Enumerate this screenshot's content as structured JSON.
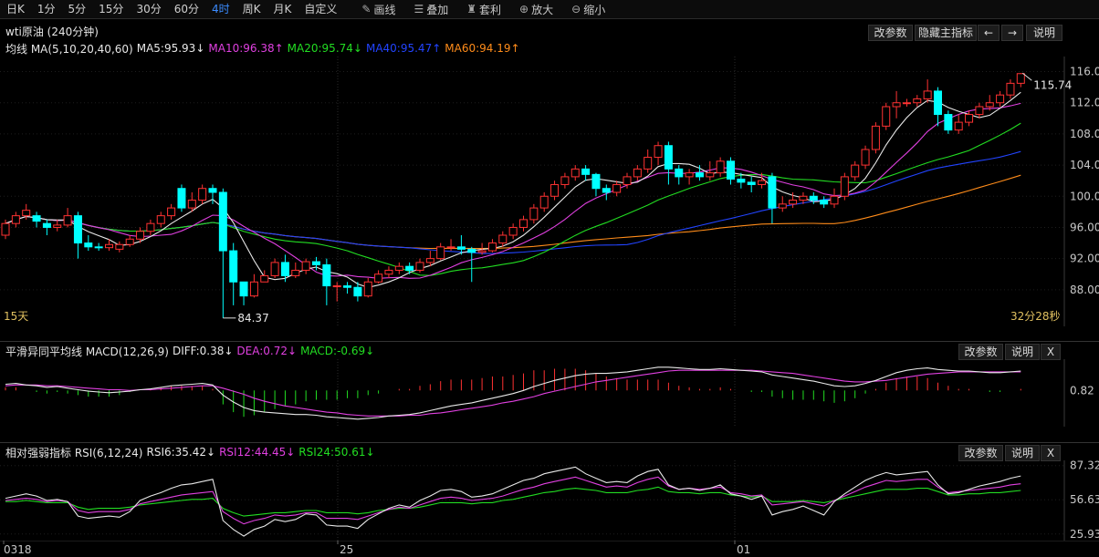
{
  "toolbar": {
    "periods": [
      "日K",
      "1分",
      "5分",
      "15分",
      "30分",
      "60分",
      "4时",
      "周K",
      "月K",
      "自定义"
    ],
    "active_period": "4时",
    "tools": [
      {
        "label": "画线",
        "icon": "pencil-icon"
      },
      {
        "label": "叠加",
        "icon": "stack-icon"
      },
      {
        "label": "套利",
        "icon": "bag-icon"
      },
      {
        "label": "放大",
        "icon": "zoom-in-icon"
      },
      {
        "label": "缩小",
        "icon": "zoom-out-icon"
      }
    ]
  },
  "main": {
    "title": "wti原油 (240分钟)",
    "buttons": {
      "params": "改参数",
      "hide": "隐藏主指标",
      "left": "←",
      "right": "→",
      "help": "说明"
    },
    "indicator": {
      "name": "均线 MA(5,10,20,40,60)",
      "items": [
        {
          "text": "MA5:95.93↓",
          "color": "#e8e8e8"
        },
        {
          "text": "MA10:96.38↑",
          "color": "#e040e0"
        },
        {
          "text": "MA20:95.74↓",
          "color": "#22dd22"
        },
        {
          "text": "MA40:95.47↑",
          "color": "#2244ff"
        },
        {
          "text": "MA60:94.19↑",
          "color": "#ff8c1a"
        }
      ]
    },
    "period_label": "15天",
    "timer": "32分28秒",
    "high_label": "115.74",
    "low_label": "84.37"
  },
  "macd": {
    "title": "平滑异同平均线 MACD(12,26,9)",
    "items": [
      {
        "text": "DIFF:0.38↓",
        "color": "#e8e8e8"
      },
      {
        "text": "DEA:0.72↓",
        "color": "#e040e0"
      },
      {
        "text": "MACD:-0.69↓",
        "color": "#22dd22"
      }
    ],
    "buttons": {
      "params": "改参数",
      "help": "说明",
      "close": "X"
    },
    "axis_label": "0.82"
  },
  "rsi": {
    "title": "相对强弱指标 RSI(6,12,24)",
    "items": [
      {
        "text": "RSI6:35.42↓",
        "color": "#e8e8e8"
      },
      {
        "text": "RSI12:44.45↓",
        "color": "#e040e0"
      },
      {
        "text": "RSI24:50.61↓",
        "color": "#22dd22"
      }
    ],
    "buttons": {
      "params": "改参数",
      "help": "说明",
      "close": "X"
    },
    "axis_labels": [
      "87.32",
      "56.63",
      "25.93"
    ]
  },
  "x_axis": [
    "0318",
    "25",
    "01"
  ],
  "chart_data": [
    {
      "type": "candlestick",
      "y_ticks": [
        "116.00",
        "112.00",
        "108.00",
        "104.00",
        "100.00",
        "96.00",
        "92.00",
        "88.00"
      ],
      "ylim": [
        84,
        117
      ],
      "colors": {
        "up": "#ff3232",
        "down": "#00ffff",
        "ma5": "#e8e8e8",
        "ma10": "#e040e0",
        "ma20": "#22dd22",
        "ma40": "#2244ff",
        "ma60": "#ff8c1a"
      },
      "candles": [
        [
          95,
          96.5,
          94.5,
          97
        ],
        [
          96.5,
          97.5,
          96,
          98
        ],
        [
          97.5,
          98.2,
          97,
          99
        ],
        [
          97.5,
          96.8,
          96,
          98
        ],
        [
          96.5,
          96,
          95,
          97
        ],
        [
          96,
          96.3,
          95.5,
          97
        ],
        [
          96.3,
          97.5,
          96,
          98.5
        ],
        [
          97.5,
          94,
          92,
          98
        ],
        [
          94,
          93.5,
          93,
          95
        ],
        [
          93.5,
          93.4,
          93,
          94
        ],
        [
          93.4,
          93.8,
          93,
          94.5
        ],
        [
          93.2,
          93.8,
          92.8,
          94.2
        ],
        [
          93.8,
          94.5,
          93.5,
          95
        ],
        [
          94.5,
          95.5,
          94,
          96
        ],
        [
          95.5,
          96.5,
          95,
          97
        ],
        [
          96.5,
          97.5,
          96,
          98
        ],
        [
          97.5,
          98.5,
          97,
          99
        ],
        [
          101,
          98.5,
          98,
          101.5
        ],
        [
          98.5,
          99.5,
          98,
          100.5
        ],
        [
          99.5,
          101,
          99,
          101.5
        ],
        [
          101,
          100.5,
          99,
          101.5
        ],
        [
          100.5,
          93,
          84.37,
          101
        ],
        [
          93,
          89,
          86,
          94
        ],
        [
          89,
          87.2,
          86,
          88.5
        ],
        [
          87.2,
          89,
          87,
          90
        ],
        [
          89,
          89.8,
          89,
          90.5
        ],
        [
          89.8,
          91.5,
          89.5,
          92
        ],
        [
          91.5,
          89.8,
          89,
          92.5
        ],
        [
          89.8,
          90.5,
          89.5,
          91.5
        ],
        [
          90.5,
          91.6,
          90,
          92
        ],
        [
          91.6,
          91.2,
          90.5,
          92.2
        ],
        [
          91.2,
          88.5,
          86,
          92
        ],
        [
          88.5,
          88.5,
          86.5,
          89
        ],
        [
          88.5,
          88.3,
          87.5,
          89
        ],
        [
          88.3,
          87.2,
          86.5,
          89
        ],
        [
          87.2,
          89,
          87,
          89.5
        ],
        [
          89,
          90,
          88.8,
          90.5
        ],
        [
          90,
          90.5,
          89.5,
          91
        ],
        [
          90.5,
          91,
          90,
          91.5
        ],
        [
          91,
          90.5,
          90,
          91.5
        ],
        [
          90.5,
          91.5,
          90.2,
          92
        ],
        [
          91.5,
          92,
          91,
          93
        ],
        [
          92,
          93.5,
          91.8,
          94
        ],
        [
          93.5,
          93.5,
          93,
          94.5
        ],
        [
          93.5,
          93.2,
          92.5,
          95
        ],
        [
          93.2,
          92.8,
          89,
          93.5
        ],
        [
          92.8,
          93,
          92.5,
          94
        ],
        [
          93,
          94,
          92.8,
          94.5
        ],
        [
          94,
          95,
          93.5,
          95.5
        ],
        [
          95,
          96,
          94.5,
          96.5
        ],
        [
          96,
          97,
          95.5,
          97.5
        ],
        [
          97,
          98.5,
          96.5,
          99
        ],
        [
          98.5,
          100,
          98,
          100.5
        ],
        [
          100,
          101.5,
          99.5,
          102
        ],
        [
          101.5,
          102.5,
          101,
          103
        ],
        [
          102.5,
          103.5,
          102,
          104
        ],
        [
          103.5,
          102.8,
          102,
          104
        ],
        [
          102.8,
          101,
          100,
          103
        ],
        [
          101,
          100.5,
          99.5,
          101.5
        ],
        [
          100.5,
          101.5,
          100,
          102
        ],
        [
          101.5,
          102.5,
          101,
          103
        ],
        [
          102.5,
          103.5,
          102,
          104
        ],
        [
          103.5,
          105,
          103,
          106
        ],
        [
          105,
          106.5,
          104,
          107
        ],
        [
          106.5,
          103.5,
          101.5,
          107
        ],
        [
          103.5,
          102.5,
          101.5,
          104
        ],
        [
          102.5,
          103,
          101.5,
          103.5
        ],
        [
          103,
          102.5,
          102,
          104
        ],
        [
          102.5,
          103,
          102,
          104.5
        ],
        [
          103,
          104.5,
          102.5,
          105
        ],
        [
          104.5,
          102.2,
          101.5,
          105
        ],
        [
          102.2,
          101.8,
          101,
          103
        ],
        [
          101.8,
          101.5,
          100.5,
          102.5
        ],
        [
          101.5,
          102,
          101,
          103
        ],
        [
          102.5,
          98.5,
          96.5,
          103
        ],
        [
          98.5,
          99,
          98,
          100
        ],
        [
          99,
          99.5,
          98.5,
          100.5
        ],
        [
          99.5,
          100,
          99,
          100.5
        ],
        [
          100,
          99.5,
          99,
          100.5
        ],
        [
          99.5,
          99,
          98.5,
          100
        ],
        [
          99,
          100,
          98.5,
          101
        ],
        [
          100,
          102.5,
          99.5,
          103
        ],
        [
          102.5,
          104,
          102,
          104.5
        ],
        [
          104,
          106,
          103.5,
          106.5
        ],
        [
          106,
          109,
          105.5,
          109.5
        ],
        [
          109,
          111.5,
          108.5,
          112
        ],
        [
          111.5,
          112,
          110,
          113.5
        ],
        [
          112,
          112,
          111.5,
          112.5
        ],
        [
          112,
          112.5,
          111.5,
          113
        ],
        [
          112.5,
          113.5,
          112,
          115
        ],
        [
          113.5,
          110.5,
          109,
          114
        ],
        [
          110.5,
          108.5,
          108,
          111
        ],
        [
          108.5,
          109.5,
          108,
          110.5
        ],
        [
          109.5,
          110.5,
          109,
          111
        ],
        [
          110.5,
          111.5,
          110,
          112
        ],
        [
          111.5,
          112,
          111,
          113
        ],
        [
          112,
          113,
          111.5,
          113.5
        ],
        [
          113,
          114.5,
          112.5,
          115
        ],
        [
          114.5,
          115.74,
          114,
          115.8
        ]
      ]
    },
    {
      "type": "macd",
      "ylim": [
        -4.2,
        3.8
      ],
      "zero_ref": 0.82,
      "diff": [
        0.8,
        0.9,
        0.7,
        0.6,
        0.4,
        0.5,
        0.3,
        0.1,
        -0.1,
        -0.2,
        -0.3,
        -0.2,
        -0.1,
        0.1,
        0.2,
        0.4,
        0.6,
        0.7,
        0.8,
        0.9,
        0.7,
        -0.6,
        -1.5,
        -2.2,
        -2.6,
        -2.8,
        -2.9,
        -3.0,
        -3.1,
        -3.1,
        -3.2,
        -3.4,
        -3.5,
        -3.6,
        -3.7,
        -3.6,
        -3.5,
        -3.3,
        -3.2,
        -3.1,
        -2.9,
        -2.6,
        -2.3,
        -2.0,
        -1.8,
        -1.6,
        -1.3,
        -1.0,
        -0.7,
        -0.4,
        0.0,
        0.5,
        0.9,
        1.3,
        1.6,
        1.9,
        2.1,
        2.2,
        2.2,
        2.3,
        2.4,
        2.6,
        2.8,
        3.0,
        3.0,
        2.9,
        2.8,
        2.7,
        2.7,
        2.8,
        2.7,
        2.6,
        2.5,
        2.4,
        2.0,
        1.8,
        1.6,
        1.4,
        1.2,
        0.9,
        0.6,
        0.5,
        0.6,
        0.9,
        1.3,
        1.8,
        2.3,
        2.6,
        2.8,
        2.9,
        2.7,
        2.6,
        2.5,
        2.5,
        2.4,
        2.3,
        2.3,
        2.4,
        2.5
      ],
      "dea": [
        0.6,
        0.7,
        0.7,
        0.7,
        0.6,
        0.6,
        0.5,
        0.4,
        0.3,
        0.2,
        0.1,
        0.1,
        0.0,
        0.1,
        0.1,
        0.2,
        0.3,
        0.4,
        0.5,
        0.6,
        0.6,
        0.3,
        -0.1,
        -0.5,
        -1.0,
        -1.4,
        -1.7,
        -2.0,
        -2.2,
        -2.4,
        -2.6,
        -2.8,
        -2.9,
        -3.1,
        -3.2,
        -3.3,
        -3.3,
        -3.3,
        -3.3,
        -3.2,
        -3.2,
        -3.0,
        -2.9,
        -2.7,
        -2.5,
        -2.3,
        -2.1,
        -1.9,
        -1.6,
        -1.4,
        -1.1,
        -0.8,
        -0.4,
        -0.1,
        0.2,
        0.5,
        0.8,
        1.1,
        1.3,
        1.5,
        1.7,
        1.9,
        2.1,
        2.3,
        2.5,
        2.6,
        2.6,
        2.6,
        2.6,
        2.6,
        2.6,
        2.6,
        2.6,
        2.5,
        2.4,
        2.3,
        2.2,
        2.0,
        1.8,
        1.6,
        1.4,
        1.2,
        1.1,
        1.1,
        1.2,
        1.3,
        1.5,
        1.7,
        1.9,
        2.1,
        2.2,
        2.3,
        2.4,
        2.4,
        2.4,
        2.4,
        2.4,
        2.4,
        2.4
      ]
    },
    {
      "type": "rsi",
      "ylim": [
        20,
        92
      ],
      "rsi6": [
        58,
        60,
        62,
        60,
        56,
        57,
        55,
        42,
        40,
        41,
        42,
        41,
        46,
        56,
        60,
        63,
        67,
        70,
        71,
        73,
        75,
        38,
        30,
        24,
        30,
        33,
        39,
        37,
        39,
        44,
        43,
        34,
        33,
        33,
        31,
        39,
        44,
        49,
        52,
        50,
        56,
        60,
        65,
        66,
        64,
        59,
        60,
        62,
        66,
        70,
        74,
        76,
        80,
        82,
        84,
        86,
        80,
        76,
        72,
        73,
        72,
        78,
        82,
        84,
        70,
        66,
        67,
        65,
        67,
        70,
        62,
        60,
        57,
        60,
        43,
        46,
        48,
        51,
        47,
        43,
        55,
        62,
        68,
        74,
        78,
        81,
        79,
        80,
        81,
        82,
        70,
        62,
        63,
        66,
        69,
        71,
        73,
        76,
        78
      ],
      "rsi12": [
        56,
        57,
        58,
        57,
        55,
        56,
        55,
        47,
        45,
        46,
        46,
        46,
        48,
        53,
        55,
        57,
        59,
        61,
        62,
        63,
        64,
        46,
        40,
        35,
        38,
        40,
        43,
        42,
        43,
        45,
        45,
        40,
        40,
        40,
        39,
        42,
        45,
        48,
        50,
        49,
        52,
        55,
        58,
        59,
        58,
        56,
        57,
        58,
        60,
        63,
        66,
        68,
        71,
        73,
        75,
        77,
        74,
        71,
        68,
        69,
        68,
        72,
        75,
        77,
        69,
        66,
        67,
        66,
        67,
        68,
        63,
        62,
        60,
        61,
        52,
        53,
        54,
        55,
        53,
        51,
        56,
        60,
        64,
        68,
        71,
        74,
        73,
        74,
        75,
        75,
        68,
        63,
        64,
        65,
        66,
        67,
        68,
        70,
        71
      ],
      "rsi24": [
        55,
        55,
        56,
        55,
        54,
        54,
        54,
        50,
        48,
        49,
        49,
        49,
        50,
        52,
        53,
        54,
        55,
        56,
        57,
        57,
        58,
        49,
        45,
        42,
        43,
        44,
        45,
        45,
        46,
        47,
        47,
        45,
        45,
        45,
        44,
        45,
        47,
        48,
        49,
        49,
        50,
        52,
        54,
        54,
        54,
        53,
        54,
        54,
        56,
        57,
        59,
        61,
        63,
        64,
        66,
        67,
        66,
        65,
        63,
        63,
        63,
        65,
        66,
        68,
        64,
        63,
        63,
        62,
        63,
        63,
        61,
        60,
        59,
        60,
        55,
        55,
        55,
        56,
        55,
        54,
        56,
        58,
        60,
        62,
        64,
        66,
        66,
        66,
        67,
        67,
        64,
        61,
        61,
        62,
        62,
        63,
        63,
        64,
        65
      ]
    }
  ]
}
